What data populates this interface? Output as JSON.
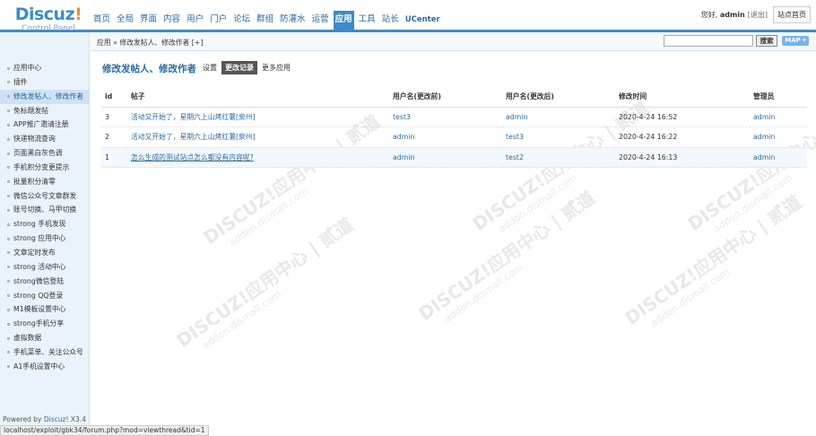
{
  "header": {
    "logo": {
      "name": "Discuz",
      "bang": "!",
      "sub": "Control Panel"
    },
    "nav": [
      {
        "label": "首页"
      },
      {
        "label": "全局"
      },
      {
        "label": "界面"
      },
      {
        "label": "内容"
      },
      {
        "label": "用户"
      },
      {
        "label": "门户"
      },
      {
        "label": "论坛"
      },
      {
        "label": "群组"
      },
      {
        "label": "防灌水"
      },
      {
        "label": "运营"
      },
      {
        "label": "应用"
      },
      {
        "label": "工具"
      },
      {
        "label": "站长"
      },
      {
        "label": "UCenter"
      }
    ],
    "active_nav": "应用",
    "greeting": "您好,",
    "username": "admin",
    "logout": "[退出]",
    "site_home": "站点首页"
  },
  "sidebar": {
    "items": [
      {
        "label": "应用中心"
      },
      {
        "label": "插件"
      },
      {
        "label": "修改发帖人、修改作者"
      },
      {
        "label": "免标题发帖"
      },
      {
        "label": "APP推广邀请注册"
      },
      {
        "label": "快递物流查询"
      },
      {
        "label": "页面黑白灰色调"
      },
      {
        "label": "手机积分变更提示"
      },
      {
        "label": "批量积分清零"
      },
      {
        "label": "微信公众号文章群发"
      },
      {
        "label": "账号切换、马甲切换"
      },
      {
        "label": "strong 手机发现"
      },
      {
        "label": "strong 应用中心"
      },
      {
        "label": "文章定时发布"
      },
      {
        "label": "strong 活动中心"
      },
      {
        "label": "strong微信登陆"
      },
      {
        "label": "strong QQ登录"
      },
      {
        "label": "M1模板设置中心"
      },
      {
        "label": "strong手机分享"
      },
      {
        "label": "虚拟数据"
      },
      {
        "label": "手机菜单、关注公众号"
      },
      {
        "label": "A1手机设置中心"
      }
    ],
    "active_index": 2,
    "powered_prefix": "Powered by",
    "powered_brand": "Discuz!",
    "powered_version": "X3.4"
  },
  "breadcrumb": "应用 » 修改发帖人、修改作者 [+]",
  "search": {
    "placeholder": "",
    "button": "搜索",
    "map": "MAP ▾"
  },
  "page": {
    "title": "修改发帖人、修改作者",
    "tabs": [
      {
        "label": "设置"
      },
      {
        "label": "更改记录"
      },
      {
        "label": "更多应用"
      }
    ],
    "current_tab": "更改记录"
  },
  "table": {
    "headers": [
      "id",
      "帖子",
      "用户名(更改前)",
      "用户名(更改后)",
      "修改时间",
      "管理员"
    ],
    "rows": [
      {
        "id": "3",
        "thread": "活动又开始了，星期六上山烤红薯[泉州]",
        "before": "test3",
        "after": "admin",
        "time": "2020-4-24 16:52",
        "admin": "admin"
      },
      {
        "id": "2",
        "thread": "活动又开始了，星期六上山烤红薯[泉州]",
        "before": "admin",
        "after": "test3",
        "time": "2020-4-24 16:22",
        "admin": "admin"
      },
      {
        "id": "1",
        "thread": "怎么生成的测试站点怎么都没有内容呢?",
        "before": "admin",
        "after": "test2",
        "time": "2020-4-24 16:13",
        "admin": "admin"
      }
    ]
  },
  "watermark": {
    "line1": "DISCUZ!应用中心 | 贰道",
    "line2": "addon.dismall.com"
  },
  "status_url": "localhost/exploit/gbk34/forum.php?mod=viewthread&tid=1"
}
